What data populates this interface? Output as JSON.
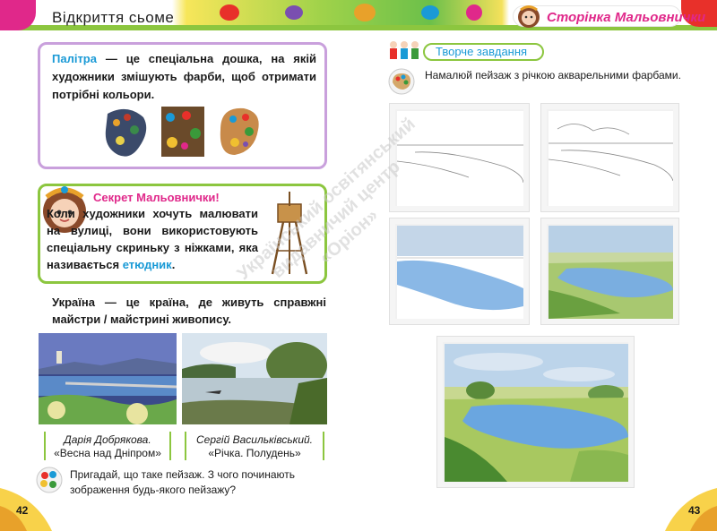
{
  "header": {
    "left_title": "Відкриття сьоме",
    "right_title": "Сторінка Мальовнички"
  },
  "palette_box": {
    "term": "Палітра",
    "text": " — це спеціальна дошка, на якій художники змішують фарби, щоб отримати потрібні кольори."
  },
  "secret_box": {
    "title": "Секрет Мальовнички!",
    "text_before": "Коли художники хочуть малювати на вулиці, вони використовують спеціальну скриньку з ніжками, яка називається ",
    "term": "етюдник",
    "text_after": "."
  },
  "paragraph": "Україна — це країна, де живуть справжні майстри / майстрині живопису.",
  "artworks": [
    {
      "artist": "Дарія Добрякова.",
      "title": "«Весна над Дніпром»"
    },
    {
      "artist": "Сергій Васильківський.",
      "title": "«Річка. Полудень»"
    }
  ],
  "question": "Пригадай, що таке пейзаж. З чого починають зображення будь-якого пейзажу?",
  "task": {
    "label": "Творче завдання",
    "text": "Намалюй пейзаж з річкою акварельними фарбами."
  },
  "watermark": {
    "line1": "Український освітянський",
    "line2": "видавничий центр",
    "line3": "«Оріон»"
  },
  "page_numbers": {
    "left": "42",
    "right": "43"
  },
  "colors": {
    "accent_pink": "#e0288a",
    "accent_blue": "#1a9ad6",
    "accent_green": "#8cc63f",
    "accent_purple": "#c9a0dc"
  }
}
